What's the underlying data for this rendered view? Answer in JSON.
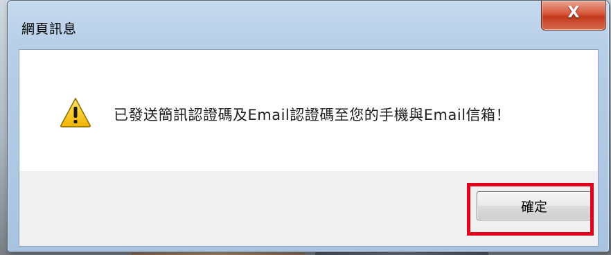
{
  "dialog": {
    "title": "網頁訊息",
    "close_icon": "x-icon",
    "close_glyph": "X",
    "message": "已發送簡訊認證碼及Email認證碼至您的手機與Email信箱！",
    "message_icon": "warning-icon",
    "ok_label": "確定"
  },
  "colors": {
    "highlight": "#e3001b",
    "close_button": "#c2391c",
    "warning_fill": "#f5c400"
  }
}
